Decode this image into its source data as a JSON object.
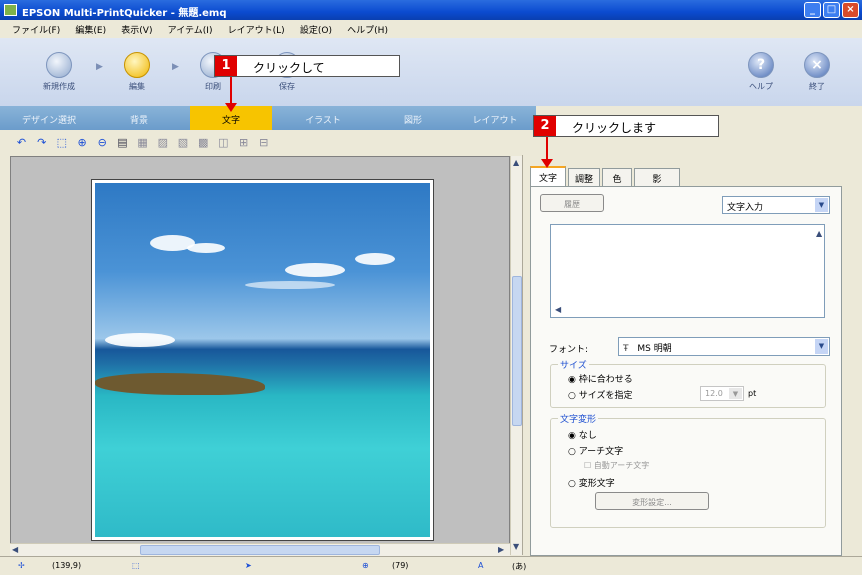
{
  "window": {
    "title": "EPSON Multi-PrintQuicker - 無題.emq",
    "min_label": "_",
    "max_label": "□",
    "close_label": "×"
  },
  "menu": [
    "ファイル(F)",
    "編集(E)",
    "表示(V)",
    "アイテム(I)",
    "レイアウト(L)",
    "設定(O)",
    "ヘルプ(H)"
  ],
  "toolbar": {
    "steps": [
      {
        "label": "新規作成"
      },
      {
        "label": "編集"
      },
      {
        "label": "印刷"
      },
      {
        "label": "保存"
      }
    ],
    "help_label": "ヘルプ",
    "exit_label": "終了",
    "help_glyph": "?",
    "exit_glyph": "×"
  },
  "main_tabs": [
    "デザイン選択",
    "背景",
    "文字",
    "イラスト",
    "図形",
    "レイアウト"
  ],
  "active_main_tab": "文字",
  "icon_toolbar": [
    "undo-icon",
    "redo-icon",
    "select-icon",
    "zoom-in-icon",
    "zoom-out-icon",
    "fit-icon",
    "align-left-icon",
    "align-center-icon",
    "align-right-icon",
    "layer-up-icon",
    "layer-down-icon",
    "group-icon",
    "ungroup-icon"
  ],
  "panel": {
    "tabs": [
      "文字",
      "調整",
      "色",
      "影"
    ],
    "active_tab": "文字",
    "history_button": "履歴",
    "mode_select": "文字入力",
    "font_label": "フォント:",
    "font_value": "MS 明朝",
    "size_group": {
      "label": "サイズ",
      "opt_fit": "枠に合わせる",
      "opt_specify": "サイズを指定",
      "size_value": "12.0",
      "unit": "pt"
    },
    "transform_group": {
      "label": "文字変形",
      "opt_none": "なし",
      "opt_arch": "アーチ文字",
      "opt_auto_arch": "自動アーチ文字",
      "opt_shape": "変形文字",
      "shape_button": "変形設定..."
    }
  },
  "status": {
    "coords": "(139,9)",
    "zoom": "(79)",
    "value": "(あ)"
  },
  "callouts": [
    {
      "num": "1",
      "text": "クリックして"
    },
    {
      "num": "2",
      "text": "クリックします"
    }
  ],
  "colors": {
    "title_bar": "#0b4bd0",
    "active_tab": "#f7c400",
    "callout_red": "#e00000",
    "tab_strip": "#6b9ccb"
  }
}
